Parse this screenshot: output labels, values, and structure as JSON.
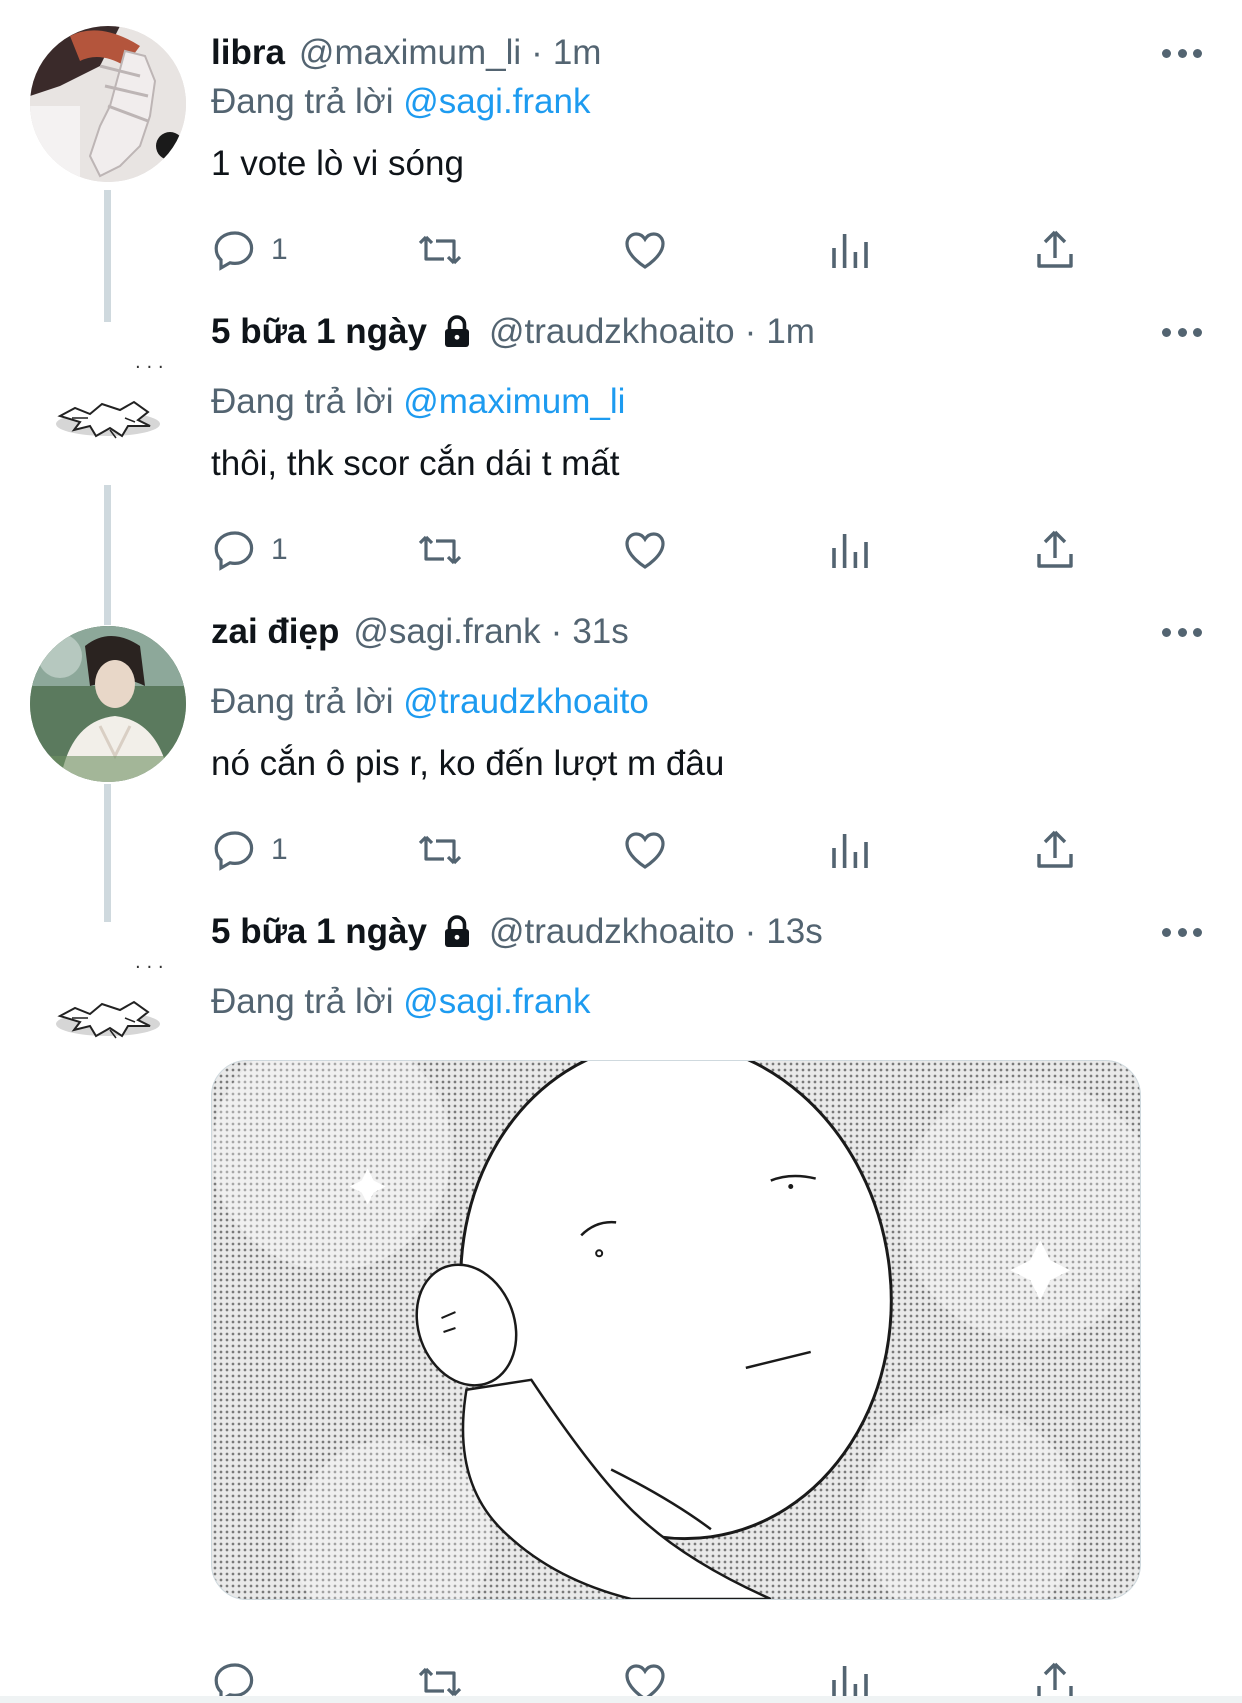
{
  "tweets": [
    {
      "name": "libra",
      "handle": "@maximum_li",
      "separator": "·",
      "time": "1m",
      "reply_prefix": "Đang trả lời",
      "reply_to": "@sagi.frank",
      "text": "1 vote lò vi sóng",
      "reply_count": "1",
      "avatar": "photo-avatar-hand"
    },
    {
      "name": "5 bữa 1 ngày",
      "locked": true,
      "handle": "@traudzkhoaito",
      "separator": "·",
      "time": "1m",
      "reply_prefix": "Đang trả lời",
      "reply_to": "@maximum_li",
      "text": "thôi, thk scor cắn dái t mất",
      "reply_count": "1",
      "avatar": "doodle-avatar"
    },
    {
      "name": "zai điẹp",
      "handle": "@sagi.frank",
      "separator": "·",
      "time": "31s",
      "reply_prefix": "Đang trả lời",
      "reply_to": "@traudzkhoaito",
      "text": "nó cắn ô pis r, ko đến lượt m đâu",
      "reply_count": "1",
      "avatar": "photo-avatar-person"
    },
    {
      "name": "5 bữa 1 ngày",
      "locked": true,
      "handle": "@traudzkhoaito",
      "separator": "·",
      "time": "13s",
      "reply_prefix": "Đang trả lời",
      "reply_to": "@sagi.frank",
      "text": "",
      "reply_count": "",
      "media": "manga-egg-head-image",
      "avatar": "doodle-avatar"
    }
  ],
  "icons": {
    "reply": "reply-icon",
    "retweet": "retweet-icon",
    "like": "heart-icon",
    "views": "views-icon",
    "share": "share-icon",
    "more": "more-icon",
    "lock": "lock-icon"
  },
  "colors": {
    "accent": "#1d9bf0",
    "secondary_text": "#536471",
    "primary_text": "#0f1419",
    "thread_line": "#cfd9de"
  }
}
